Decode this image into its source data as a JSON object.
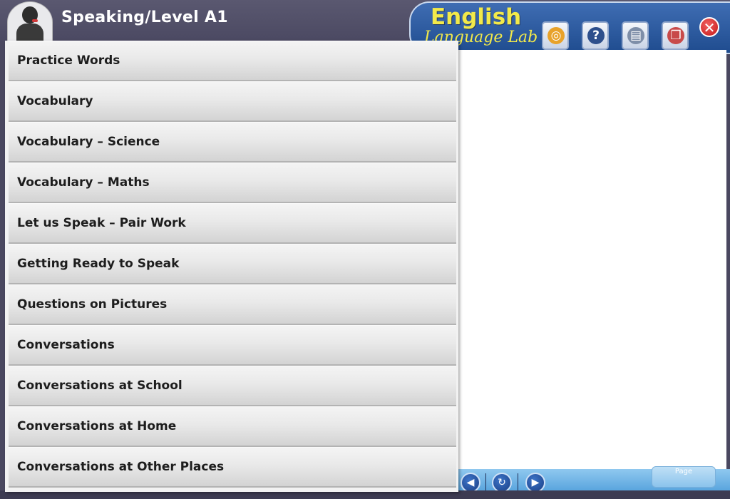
{
  "header": {
    "title": "Speaking/Level A1"
  },
  "brand": {
    "line1": "English",
    "line2": "Language Lab"
  },
  "toolbar": {
    "buttons": [
      {
        "icon": "camera-icon",
        "glyph": "◎"
      },
      {
        "icon": "help-icon",
        "glyph": "?"
      },
      {
        "icon": "book-icon",
        "glyph": "▤"
      },
      {
        "icon": "windows-icon",
        "glyph": "❐"
      }
    ],
    "close_glyph": "✕"
  },
  "menu": {
    "items": [
      {
        "label": "Practice Words"
      },
      {
        "label": "Vocabulary"
      },
      {
        "label": "Vocabulary – Science"
      },
      {
        "label": "Vocabulary – Maths"
      },
      {
        "label": "Let us Speak – Pair Work"
      },
      {
        "label": "Getting Ready to Speak"
      },
      {
        "label": "Questions on Pictures"
      },
      {
        "label": "Conversations"
      },
      {
        "label": "Conversations at School"
      },
      {
        "label": "Conversations at Home"
      },
      {
        "label": "Conversations at Other Places"
      }
    ]
  },
  "footer": {
    "page_label": "Page",
    "prev_glyph": "◀",
    "refresh_glyph": "↻",
    "next_glyph": "▶"
  },
  "colors": {
    "brand_yellow": "#f2e94a",
    "brand_blue": "#2a5aa0",
    "header_bg": "#4b4962"
  }
}
